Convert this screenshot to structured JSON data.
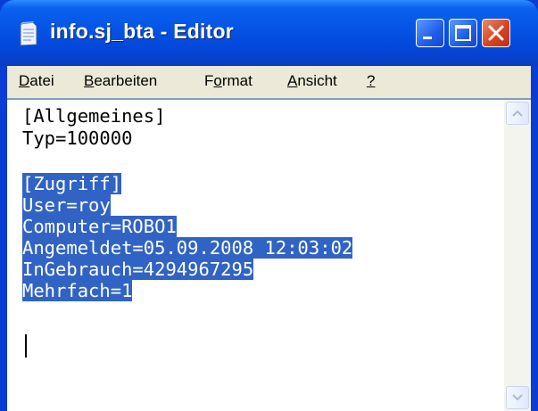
{
  "window": {
    "title": "info.sj_bta - Editor",
    "colors": {
      "titlebar": "#0655e6",
      "frame": "#0a3cd6",
      "close": "#d9431f",
      "selection": "#3163c5",
      "menubar": "#ece9d8"
    }
  },
  "menu": {
    "items": [
      {
        "key": "D",
        "rest": "atei"
      },
      {
        "key": "B",
        "rest": "earbeiten"
      },
      {
        "pre": "F",
        "key": "o",
        "rest": "rmat"
      },
      {
        "key": "A",
        "rest": "nsicht"
      },
      {
        "key": "?",
        "rest": ""
      }
    ]
  },
  "editor": {
    "lines": [
      "[Allgemeines]",
      "Typ=100000",
      "",
      "[Zugriff]",
      "User=roy",
      "Computer=ROBO1",
      "Angemeldet=05.09.2008 12:03:02",
      "InGebrauch=4294967295",
      "Mehrfach=1"
    ],
    "selected_lines": [
      3,
      4,
      5,
      6,
      7,
      8
    ]
  },
  "icons": {
    "app": "notepad-icon",
    "minimize": "minimize-icon",
    "maximize": "maximize-icon",
    "close": "close-icon",
    "scroll_up": "arrow-up-icon",
    "scroll_down": "arrow-down-icon"
  }
}
